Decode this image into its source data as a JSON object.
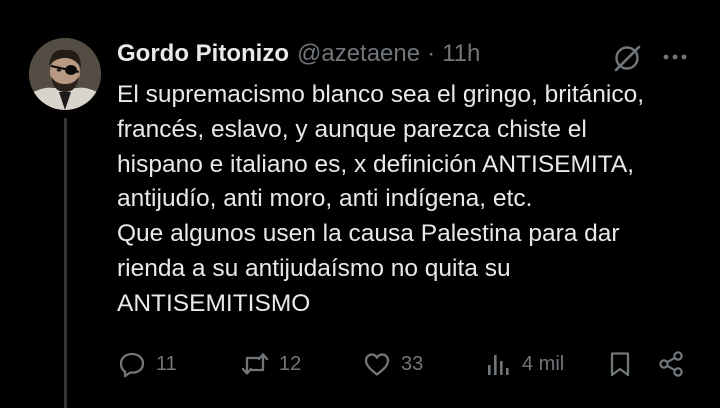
{
  "user": {
    "display_name": "Gordo Pitonizo",
    "handle": "@azetaene",
    "separator": "·",
    "time": "11h"
  },
  "tweet": {
    "lines": [
      "El supremacismo blanco sea el gringo, británico,",
      "francés, eslavo, y aunque parezca chiste el",
      "hispano e italiano es, x definición ANTISEMITA,",
      "antijudío, anti moro, anti indígena, etc.",
      "Que algunos usen la causa Palestina para dar",
      "rienda a su antijudaísmo no quita su",
      "ANTISEMITISMO"
    ]
  },
  "actions": {
    "replies": "11",
    "reposts": "12",
    "likes": "33",
    "views": "4 mil"
  },
  "icons": {
    "avatar": "avatar",
    "grok": "grok-icon",
    "more": "more-icon",
    "reply": "reply-icon",
    "repost": "repost-icon",
    "like": "heart-icon",
    "views": "views-icon",
    "bookmark": "bookmark-icon",
    "share": "share-icon"
  },
  "colors": {
    "background": "#000000",
    "text": "#e7e9ea",
    "secondary": "#71767b",
    "thread_line": "#333639"
  }
}
